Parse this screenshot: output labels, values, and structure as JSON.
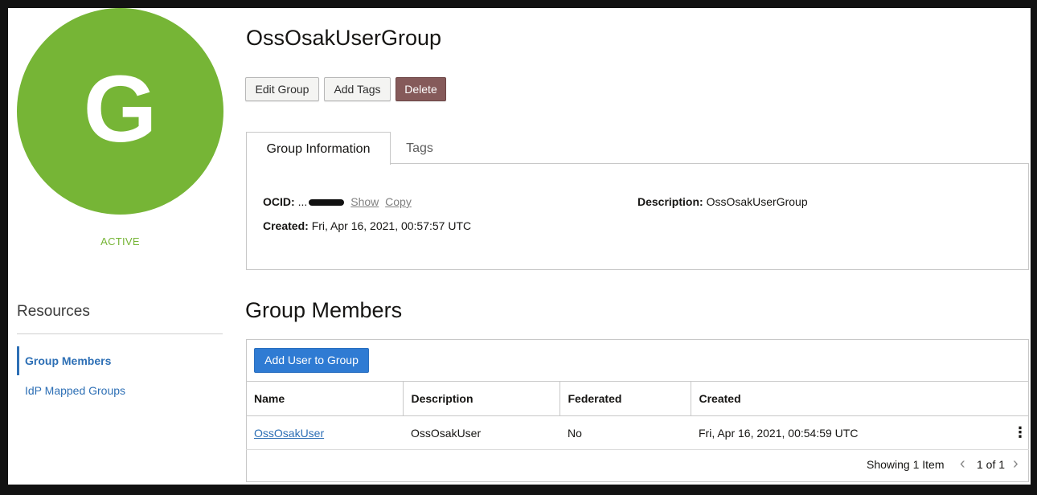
{
  "group": {
    "avatar_letter": "G",
    "status": "ACTIVE",
    "title": "OssOsakUserGroup",
    "colors": {
      "avatar": "#76b536",
      "link": "#2d6fb5",
      "delete": "#855a5a",
      "primary": "#2f7bd3"
    }
  },
  "actions": {
    "edit_label": "Edit Group",
    "tags_label": "Add Tags",
    "delete_label": "Delete"
  },
  "tabs": [
    {
      "label": "Group Information",
      "active": true
    },
    {
      "label": "Tags",
      "active": false
    }
  ],
  "info": {
    "ocid_label": "OCID:",
    "ocid_value": "...",
    "show_label": "Show",
    "copy_label": "Copy",
    "created_label": "Created:",
    "created_value": "Fri, Apr 16, 2021, 00:57:57 UTC",
    "description_label": "Description:",
    "description_value": "OssOsakUserGroup"
  },
  "resources": {
    "title": "Resources",
    "items": [
      {
        "label": "Group Members",
        "active": true
      },
      {
        "label": "IdP Mapped Groups",
        "active": false
      }
    ]
  },
  "members": {
    "title": "Group Members",
    "add_button": "Add User to Group",
    "columns": [
      "Name",
      "Description",
      "Federated",
      "Created"
    ],
    "rows": [
      {
        "name": "OssOsakUser",
        "description": "OssOsakUser",
        "federated": "No",
        "created": "Fri, Apr 16, 2021, 00:54:59 UTC"
      }
    ],
    "row_menu_icon": "kebab-icon",
    "pagination": {
      "showing": "Showing 1 Item",
      "page": "1 of 1",
      "prev_icon": "chevron-left-icon",
      "next_icon": "chevron-right-icon"
    }
  }
}
